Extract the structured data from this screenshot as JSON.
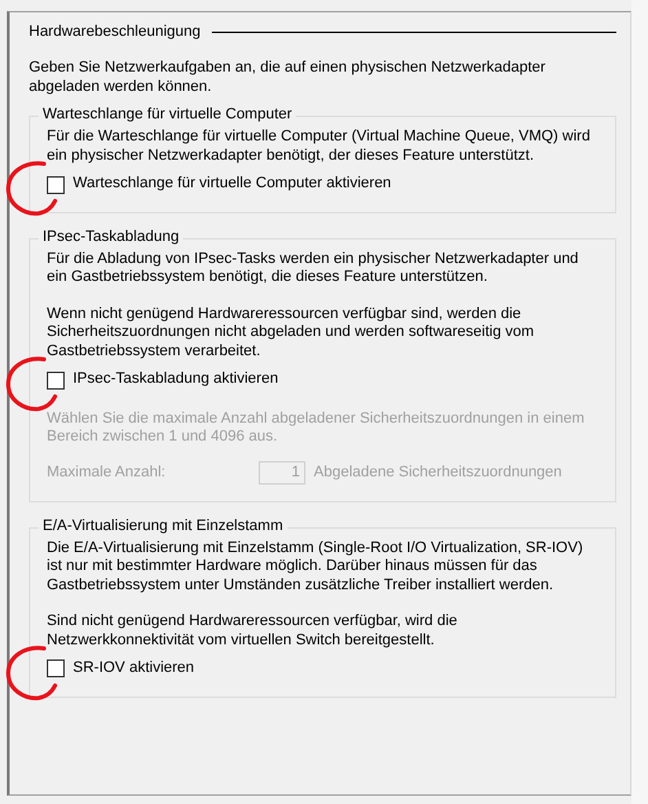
{
  "panel": {
    "title": "Hardwarebeschleunigung",
    "intro": "Geben Sie Netzwerkaufgaben an, die auf einen physischen Netzwerkadapter abgeladen werden können."
  },
  "sections": [
    {
      "title": "Warteschlange für virtuelle Computer",
      "paragraphs": [
        "Für die Warteschlange für virtuelle Computer (Virtual Machine Queue, VMQ) wird ein physischer Netzwerkadapter benötigt, der dieses Feature unterstützt."
      ],
      "checkbox": {
        "label": "Warteschlange für virtuelle Computer aktivieren",
        "checked": false,
        "annotated": true
      }
    },
    {
      "title": "IPsec-Taskabladung",
      "paragraphs": [
        "Für die Abladung von IPsec-Tasks werden ein physischer Netzwerkadapter und ein Gastbetriebssystem benötigt, die dieses Feature unterstützen.",
        "Wenn nicht genügend Hardwareressourcen verfügbar sind, werden die Sicherheitszuordnungen nicht abgeladen und werden softwareseitig vom Gastbetriebssystem verarbeitet."
      ],
      "checkbox": {
        "label": "IPsec-Taskabladung aktivieren",
        "checked": false,
        "annotated": true
      },
      "limit": {
        "disabled": true,
        "text": "Wählen Sie die maximale Anzahl abgeladener Sicherheitszuordnungen in einem Bereich zwischen 1 und 4096 aus.",
        "label": "Maximale Anzahl:",
        "value": "1",
        "unit": "Abgeladene Sicherheitszuordnungen"
      }
    },
    {
      "title": "E/A-Virtualisierung mit Einzelstamm",
      "paragraphs": [
        "Die E/A-Virtualisierung mit Einzelstamm (Single-Root I/O Virtualization, SR-IOV) ist nur mit bestimmter Hardware möglich. Darüber hinaus müssen für das Gastbetriebssystem unter Umständen zusätzliche Treiber installiert werden.",
        "Sind nicht genügend Hardwareressourcen verfügbar, wird die Netzwerkkonnektivität vom virtuellen Switch bereitgestellt."
      ],
      "checkbox": {
        "label": "SR-IOV aktivieren",
        "checked": false,
        "annotated": true
      }
    }
  ]
}
